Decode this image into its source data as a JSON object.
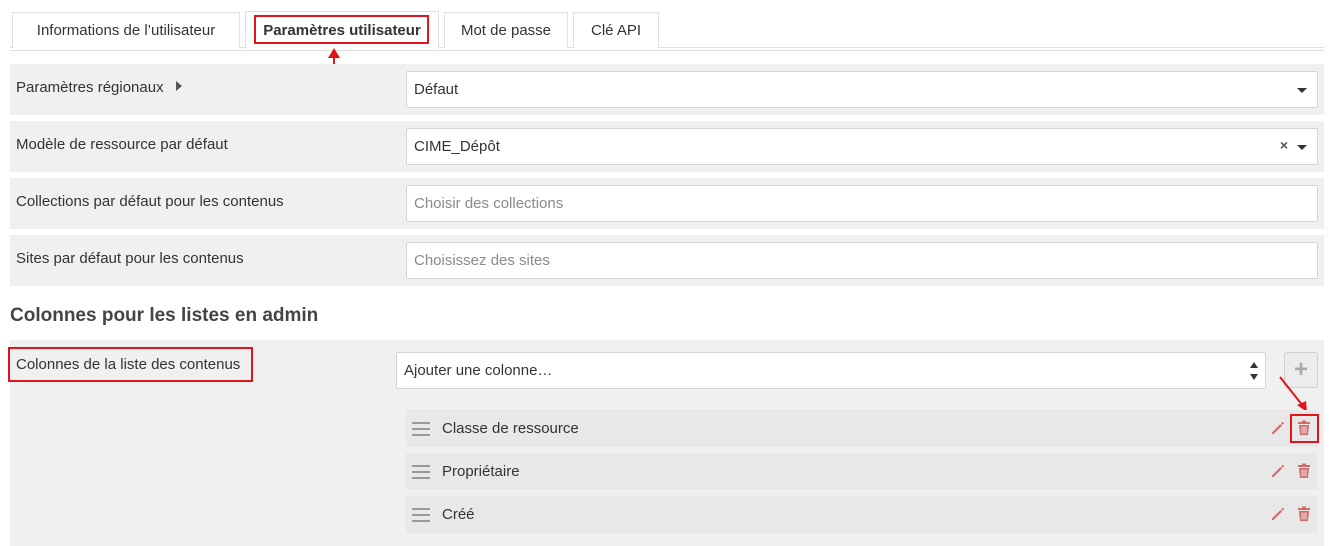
{
  "tabs": [
    {
      "label": "Informations de l’utilisateur",
      "active": false
    },
    {
      "label": "Paramètres utilisateur",
      "active": true
    },
    {
      "label": "Mot de passe",
      "active": false
    },
    {
      "label": "Clé API",
      "active": false
    }
  ],
  "fields": {
    "regional": {
      "label": "Paramètres régionaux",
      "value": "Défaut"
    },
    "resource_template": {
      "label": "Modèle de ressource par défaut",
      "value": "CIME_Dépôt"
    },
    "collections": {
      "label": "Collections par défaut pour les contenus",
      "placeholder": "Choisir des collections"
    },
    "sites": {
      "label": "Sites par défaut pour les contenus",
      "placeholder": "Choisissez des sites"
    }
  },
  "section_title": "Colonnes pour les listes en admin",
  "columns": {
    "label": "Colonnes de la liste des contenus",
    "add_placeholder": "Ajouter une colonne…",
    "add_button": "+",
    "items": [
      {
        "name": "Classe de ressource"
      },
      {
        "name": "Propriétaire"
      },
      {
        "name": "Créé"
      }
    ]
  },
  "colors": {
    "accent_highlight": "#e0141a",
    "action_icon": "#d26a6a"
  }
}
